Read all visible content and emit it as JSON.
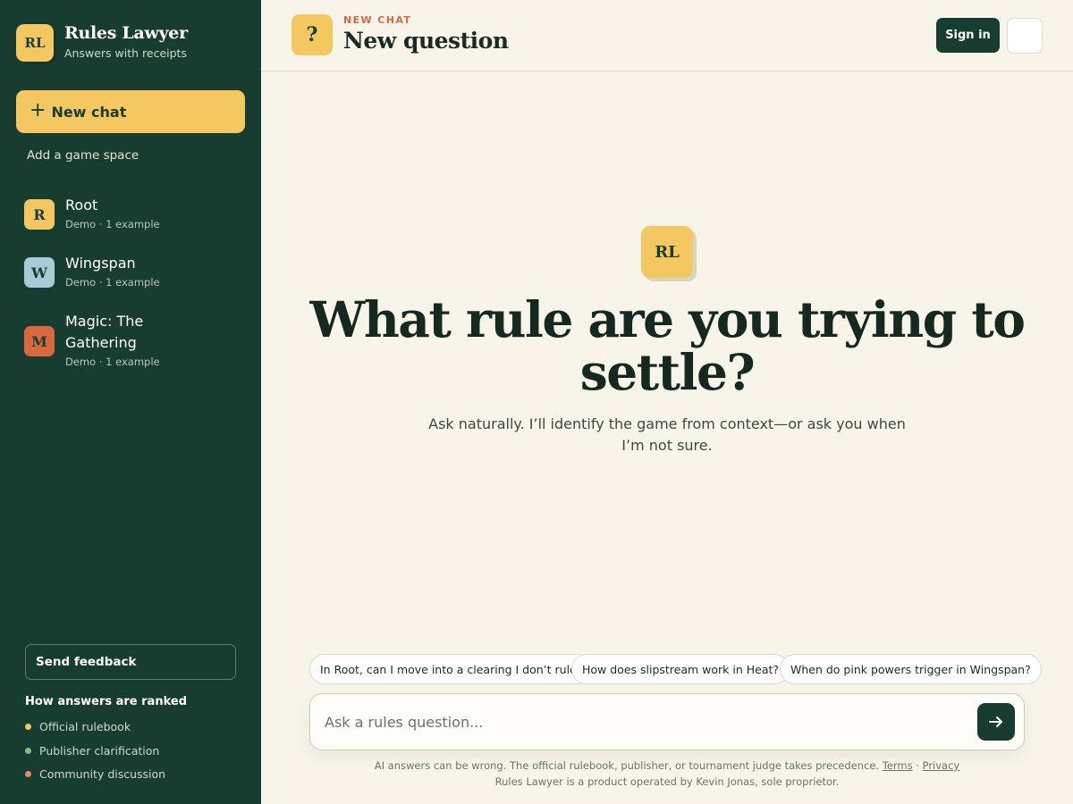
{
  "brand": {
    "logo": "RL",
    "title": "Rules Lawyer",
    "subtitle": "Answers with receipts"
  },
  "sidebar": {
    "new_chat_label": "New chat",
    "add_space_label": "Add a game space",
    "games": [
      {
        "badge": "R",
        "name": "Root",
        "meta": "Demo · 1 example",
        "color": "#f5c760"
      },
      {
        "badge": "W",
        "name": "Wingspan",
        "meta": "Demo · 1 example",
        "color": "#a8cbd6"
      },
      {
        "badge": "M",
        "name": "Magic: The Gathering",
        "meta": "Demo · 1 example",
        "color": "#d9683f"
      }
    ],
    "feedback_label": "Send feedback",
    "ranked_title": "How answers are ranked",
    "ranked_items": [
      {
        "label": "Official rulebook",
        "color": "#f5c760"
      },
      {
        "label": "Publisher clarification",
        "color": "#7fbf8a"
      },
      {
        "label": "Community discussion",
        "color": "#e08a6c"
      }
    ]
  },
  "header": {
    "badge": "?",
    "kicker": "NEW CHAT",
    "title": "New question",
    "sign_in_label": "Sign in"
  },
  "hero": {
    "logo": "RL",
    "title": "What rule are you trying to settle?",
    "subtitle": "Ask naturally. I’ll identify the game from context—or ask you when I’m not sure."
  },
  "suggestions": [
    "In Root, can I move into a clearing I don’t rule?",
    "How does slipstream work in Heat?",
    "When do pink powers trigger in Wingspan?"
  ],
  "composer": {
    "placeholder": "Ask a rules question..."
  },
  "footer": {
    "disclaimer": "AI answers can be wrong. The official rulebook, publisher, or tournament judge takes precedence.",
    "terms_label": "Terms",
    "separator": "·",
    "privacy_label": "Privacy",
    "operator": "Rules Lawyer is a product operated by Kevin Jonas, sole proprietor."
  },
  "colors": {
    "sidebar_bg": "#173d31",
    "accent": "#f5c760",
    "page_bg": "#f7f4ea",
    "kicker": "#d46a3c"
  }
}
